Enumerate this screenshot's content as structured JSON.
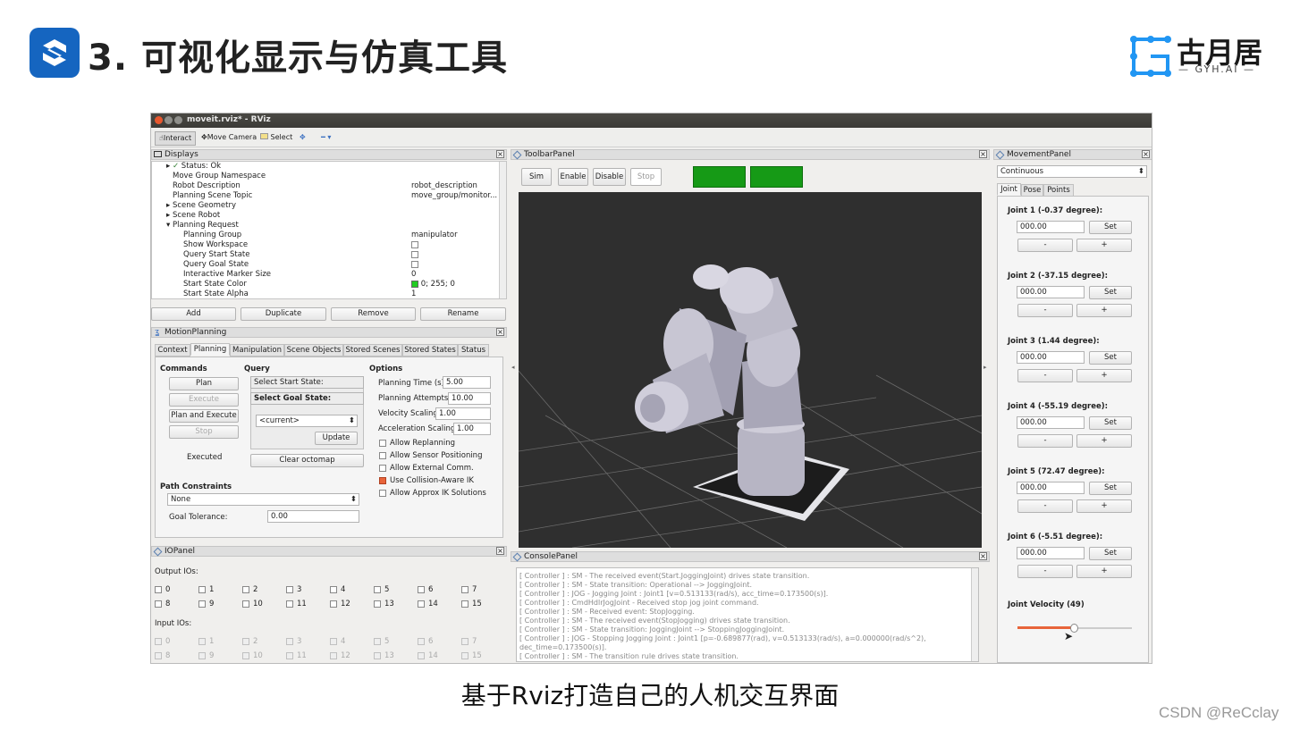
{
  "slide": {
    "title": "3. 可视化显示与仿真工具",
    "brand_name": "古月居",
    "brand_sub": "— GYH.AI —",
    "caption": "基于Rviz打造自己的人机交互界面",
    "watermark": "CSDN @ReCclay"
  },
  "window": {
    "title": "moveit.rviz* - RViz",
    "toolbar": [
      "Interact",
      "Move Camera",
      "Select"
    ]
  },
  "displays": {
    "header": "Displays",
    "rows": [
      {
        "label": "Status: Ok",
        "value": ""
      },
      {
        "label": "Move Group Namespace",
        "value": ""
      },
      {
        "label": "Robot Description",
        "value": "robot_description"
      },
      {
        "label": "Planning Scene Topic",
        "value": "move_group/monitor..."
      },
      {
        "label": "Scene Geometry",
        "value": ""
      },
      {
        "label": "Scene Robot",
        "value": ""
      },
      {
        "label": "Planning Request",
        "value": ""
      },
      {
        "label": "Planning Group",
        "value": "manipulator"
      },
      {
        "label": "Show Workspace",
        "value": ""
      },
      {
        "label": "Query Start State",
        "value": ""
      },
      {
        "label": "Query Goal State",
        "value": ""
      },
      {
        "label": "Interactive Marker Size",
        "value": "0"
      },
      {
        "label": "Start State Color",
        "value": "0; 255; 0"
      },
      {
        "label": "Start State Alpha",
        "value": "1"
      }
    ],
    "buttons": [
      "Add",
      "Duplicate",
      "Remove",
      "Rename"
    ]
  },
  "motion": {
    "header": "MotionPlanning",
    "tabs": [
      "Context",
      "Planning",
      "Manipulation",
      "Scene Objects",
      "Stored Scenes",
      "Stored States",
      "Status"
    ],
    "commands_label": "Commands",
    "query_label": "Query",
    "options_label": "Options",
    "plan": "Plan",
    "execute": "Execute",
    "plan_execute": "Plan and Execute",
    "stop": "Stop",
    "executed": "Executed",
    "start_state": "Select Start State:",
    "goal_state": "Select Goal State:",
    "current": "<current>",
    "update": "Update",
    "clear_octomap": "Clear octomap",
    "planning_time_label": "Planning Time (s):",
    "planning_time": "5.00",
    "planning_attempts_label": "Planning Attempts:",
    "planning_attempts": "10.00",
    "velocity_label": "Velocity Scaling:",
    "velocity": "1.00",
    "accel_label": "Acceleration Scaling:",
    "accel": "1.00",
    "checks": [
      "Allow Replanning",
      "Allow Sensor Positioning",
      "Allow External Comm.",
      "Use Collision-Aware IK",
      "Allow Approx IK Solutions"
    ],
    "path_constraints_label": "Path Constraints",
    "path_constraints": "None",
    "goal_tolerance_label": "Goal Tolerance:",
    "goal_tolerance": "0.00"
  },
  "io": {
    "header": "IOPanel",
    "output_label": "Output IOs:",
    "input_label": "Input IOs:",
    "numbers": [
      "0",
      "1",
      "2",
      "3",
      "4",
      "5",
      "6",
      "7",
      "8",
      "9",
      "10",
      "11",
      "12",
      "13",
      "14",
      "15"
    ]
  },
  "toolbar_panel": {
    "header": "ToolbarPanel",
    "buttons": [
      "Sim",
      "Enable",
      "Disable",
      "Stop"
    ]
  },
  "console": {
    "header": "ConsolePanel",
    "lines": [
      "[ Controller ] : SM - The received event(Start.JoggingJoint) drives state transition.",
      "[ Controller ] : SM - State transition: Operational --> JoggingJoint.",
      "[ Controller ] : JOG - Jogging Joint : Joint1 [v=0.513133(rad/s), acc_time=0.173500(s)].",
      "[ Controller ] : CmdHdlrJogJoint - Received stop jog joint command.",
      "[ Controller ] : SM - Received event: StopJogging.",
      "[ Controller ] : SM - The received event(StopJogging) drives state transition.",
      "[ Controller ] : SM - State transition: JoggingJoint --> StoppingJoggingJoint.",
      "[ Controller ] : JOG - Stopping Jogging Joint : Joint1 [p=-0.689877(rad), v=0.513133(rad/s), a=0.000000(rad/s^2),",
      "dec_time=0.173500(s)].",
      "[ Controller ] : SM - The transition rule drives state transition."
    ]
  },
  "movement": {
    "header": "MovementPanel",
    "mode": "Continuous",
    "tabs": [
      "Joint",
      "Pose",
      "Points"
    ],
    "joints": [
      {
        "label": "Joint 1 (-0.37 degree):",
        "value": "000.00"
      },
      {
        "label": "Joint 2 (-37.15 degree):",
        "value": "000.00"
      },
      {
        "label": "Joint 3 (1.44 degree):",
        "value": "000.00"
      },
      {
        "label": "Joint 4 (-55.19 degree):",
        "value": "000.00"
      },
      {
        "label": "Joint 5 (72.47 degree):",
        "value": "000.00"
      },
      {
        "label": "Joint 6 (-5.51 degree):",
        "value": "000.00"
      }
    ],
    "set": "Set",
    "minus": "-",
    "plus": "+",
    "velocity_label": "Joint Velocity (49)",
    "velocity_fraction": 0.49
  }
}
